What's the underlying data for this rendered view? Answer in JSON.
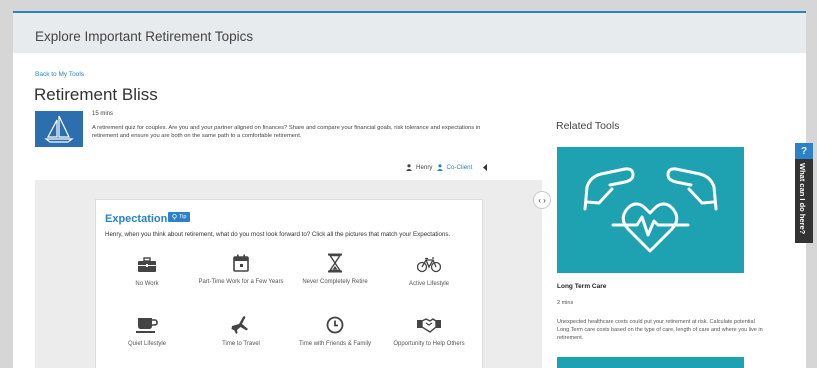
{
  "header": {
    "title": "Explore Important Retirement Topics"
  },
  "nav": {
    "back_link": "Back to My Tools"
  },
  "tool": {
    "title": "Retirement Bliss",
    "icon": "sailboat-icon",
    "duration": "15 mins",
    "description": "A retirement quiz for couples. Are you and your partner aligned on finances? Share and compare your financial goals, risk tolerance and expectations in retirement and ensure you are both on the same path to a comfortable retirement."
  },
  "users": {
    "primary": "Henry",
    "secondary": "Co-Client"
  },
  "expectations": {
    "title": "Expectations",
    "tip_label": "Tip",
    "prompt": "Henry, when you think about retirement, what do you most look forward to? Click all the pictures that match your Expectations.",
    "items": [
      {
        "label": "No Work",
        "icon": "briefcase-icon"
      },
      {
        "label": "Part-Time Work for a Few Years",
        "icon": "calendar-icon"
      },
      {
        "label": "Never Completely Retire",
        "icon": "hourglass-icon"
      },
      {
        "label": "Active Lifestyle",
        "icon": "bicycle-icon"
      },
      {
        "label": "Quiet Lifestyle",
        "icon": "coffee-cup-icon"
      },
      {
        "label": "Time to Travel",
        "icon": "airplane-icon"
      },
      {
        "label": "Time with Friends & Family",
        "icon": "clock-icon"
      },
      {
        "label": "Opportunity to Help Others",
        "icon": "handshake-icon"
      }
    ]
  },
  "related": {
    "title": "Related Tools",
    "tool_name": "Long Term Care",
    "tool_duration": "2 mins",
    "tool_description": "Unexpected healthcare costs could put your retirement at risk. Calculate potential Long Term care costs based on the type of care, length of care and where you live in retirement.",
    "image_icon": "hands-heart-icon"
  },
  "help": {
    "question_mark": "?",
    "label": "What can I do here?"
  },
  "colors": {
    "accent": "#2b82c9",
    "teal": "#1ea1b0",
    "header_bg": "#e7ebee"
  }
}
